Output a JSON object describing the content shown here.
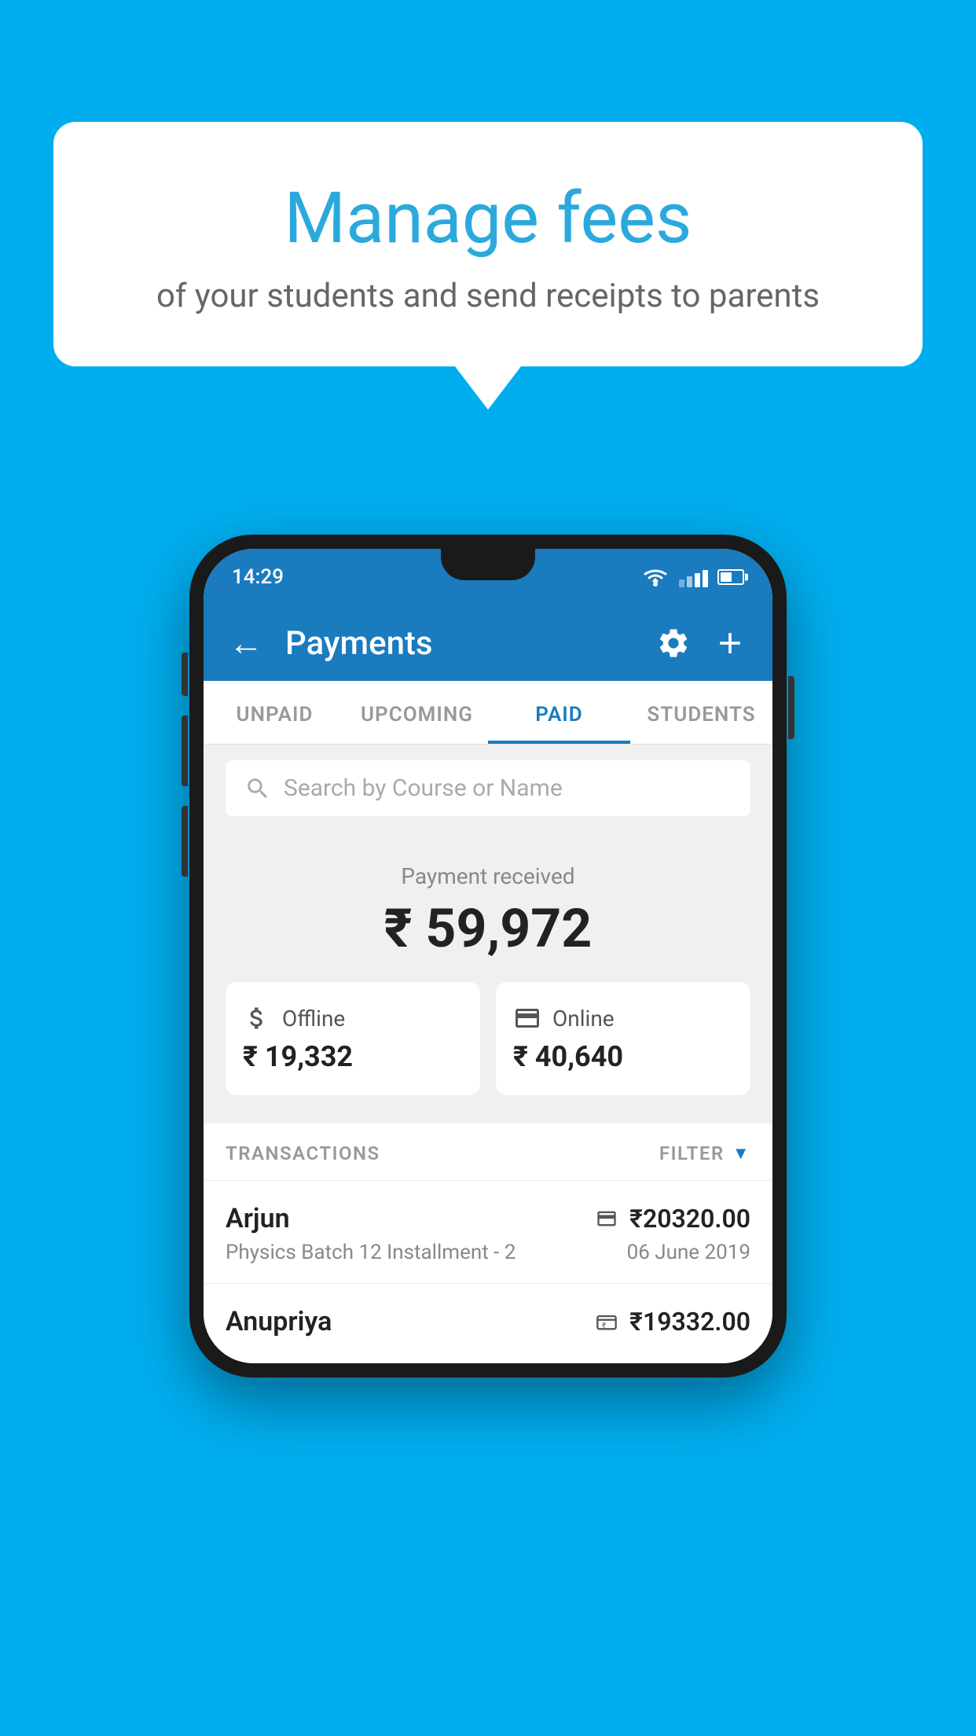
{
  "background_color": "#00AEEF",
  "speech_bubble": {
    "title": "Manage fees",
    "subtitle": "of your students and send receipts to parents"
  },
  "status_bar": {
    "time": "14:29"
  },
  "app_header": {
    "title": "Payments",
    "back_label": "←",
    "gear_label": "⚙",
    "plus_label": "+"
  },
  "tabs": [
    {
      "label": "UNPAID",
      "active": false
    },
    {
      "label": "UPCOMING",
      "active": false
    },
    {
      "label": "PAID",
      "active": true
    },
    {
      "label": "STUDENTS",
      "active": false
    }
  ],
  "search": {
    "placeholder": "Search by Course or Name"
  },
  "payment_summary": {
    "label": "Payment received",
    "total": "₹ 59,972",
    "offline_label": "Offline",
    "offline_amount": "₹ 19,332",
    "online_label": "Online",
    "online_amount": "₹ 40,640"
  },
  "transactions": {
    "label": "TRANSACTIONS",
    "filter_label": "FILTER",
    "rows": [
      {
        "name": "Arjun",
        "amount": "₹20320.00",
        "course": "Physics Batch 12 Installment - 2",
        "date": "06 June 2019",
        "payment_type": "card"
      },
      {
        "name": "Anupriya",
        "amount": "₹19332.00",
        "course": "",
        "date": "",
        "payment_type": "cash"
      }
    ]
  }
}
